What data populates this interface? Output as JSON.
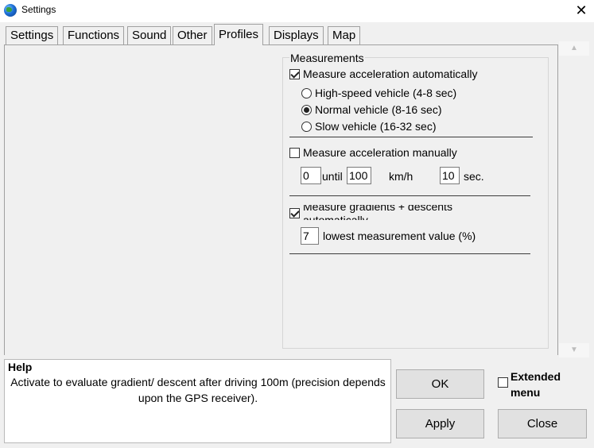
{
  "window": {
    "title": "Settings",
    "close_glyph": "✕",
    "icon": "globe-icon"
  },
  "tabs": [
    {
      "label": "Settings",
      "active": false
    },
    {
      "label": "Functions",
      "active": false
    },
    {
      "label": "Sound",
      "active": false
    },
    {
      "label": "Other",
      "active": false
    },
    {
      "label": "Profiles",
      "active": true
    },
    {
      "label": "Displays",
      "active": false
    },
    {
      "label": "Map",
      "active": false
    }
  ],
  "scrollbar": {
    "up_glyph": "▲",
    "down_glyph": "▼"
  },
  "measurements": {
    "title": "Measurements",
    "auto_accel": {
      "label": "Measure acceleration automatically",
      "checked": true,
      "options": [
        {
          "label": "High-speed vehicle (4-8 sec)",
          "selected": false
        },
        {
          "label": "Normal vehicle (8-16 sec)",
          "selected": true
        },
        {
          "label": "Slow vehicle (16-32 sec)",
          "selected": false
        }
      ]
    },
    "manual_accel": {
      "label": "Measure acceleration manually",
      "checked": false,
      "from_value": "0",
      "until_label": "until",
      "to_value": "100",
      "unit_label": "km/h",
      "sec_value": "10",
      "sec_label": "sec."
    },
    "gradients": {
      "label_line1": "Measure gradients + descents",
      "label_line2": "automatically",
      "checked": true,
      "lowest_value": "7",
      "lowest_label": "lowest measurement value (%)"
    }
  },
  "help": {
    "title": "Help",
    "text": "Activate to evaluate gradient/ descent after driving 100m (precision depends upon the GPS receiver)."
  },
  "buttons": {
    "ok": "OK",
    "apply": "Apply",
    "close": "Close"
  },
  "extended_menu": {
    "label": "Extended menu",
    "checked": false
  }
}
